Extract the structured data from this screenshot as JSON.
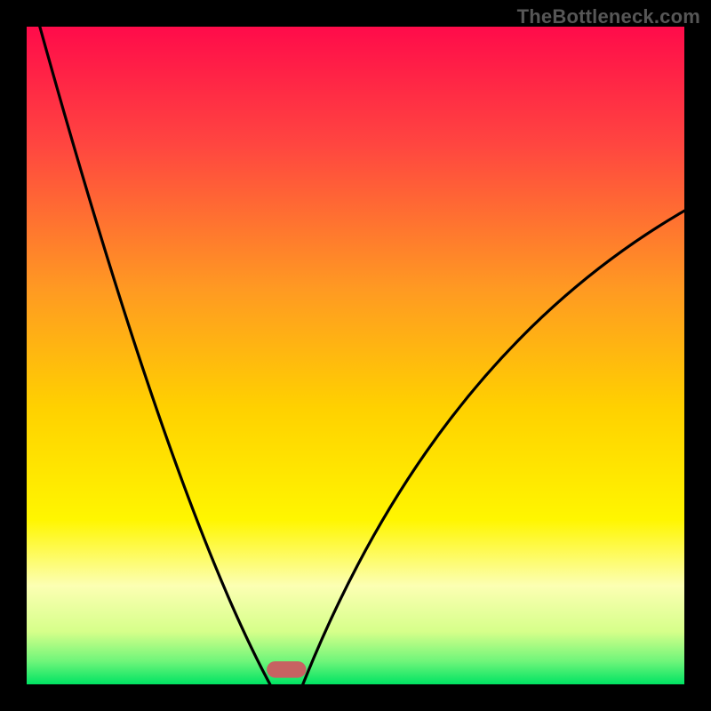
{
  "watermark": "TheBottleneck.com",
  "chart_data": {
    "type": "line",
    "title": "",
    "xlabel": "",
    "ylabel": "",
    "xlim": [
      0,
      100
    ],
    "ylim": [
      0,
      100
    ],
    "grid": false,
    "gradient_stops": [
      {
        "offset": 0.0,
        "color": "#ff0b4a"
      },
      {
        "offset": 0.18,
        "color": "#ff4640"
      },
      {
        "offset": 0.4,
        "color": "#ff9a22"
      },
      {
        "offset": 0.58,
        "color": "#ffd100"
      },
      {
        "offset": 0.75,
        "color": "#fff600"
      },
      {
        "offset": 0.85,
        "color": "#fcffb3"
      },
      {
        "offset": 0.92,
        "color": "#d6ff8a"
      },
      {
        "offset": 0.965,
        "color": "#6ff57a"
      },
      {
        "offset": 1.0,
        "color": "#00e363"
      }
    ],
    "curves": {
      "left": {
        "start_x": 2,
        "start_y": 100,
        "end_x": 37,
        "end_y": 0,
        "ctrl_x": 22,
        "ctrl_y": 28
      },
      "right": {
        "start_x": 42,
        "start_y": 0,
        "end_x": 100,
        "end_y": 72,
        "ctrl_x": 62,
        "ctrl_y": 50
      }
    },
    "marker": {
      "x_start": 36.5,
      "x_end": 42.5,
      "y": 1.0,
      "height": 2.5,
      "color": "#c76262",
      "rx": 1.3
    },
    "series": [
      {
        "name": "bottleneck-curve",
        "x": [
          0,
          5,
          10,
          15,
          20,
          25,
          30,
          35,
          37,
          40,
          42,
          45,
          50,
          55,
          60,
          65,
          70,
          75,
          80,
          85,
          90,
          95,
          100
        ],
        "values": [
          100,
          88,
          76,
          63,
          50,
          37,
          24,
          10,
          2,
          0,
          2,
          8,
          18,
          27,
          35,
          42,
          49,
          55,
          60,
          64,
          68,
          70,
          72
        ]
      }
    ]
  }
}
